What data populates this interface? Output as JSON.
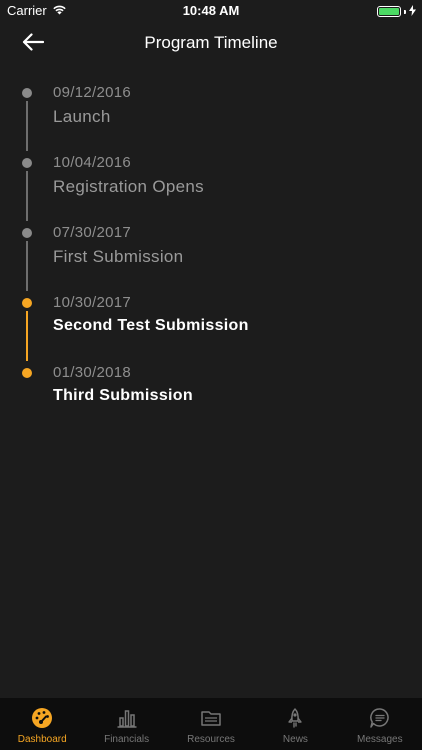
{
  "status_bar": {
    "carrier": "Carrier",
    "time": "10:48 AM"
  },
  "nav": {
    "title": "Program Timeline",
    "back_icon": "arrow-left-icon"
  },
  "colors": {
    "background": "#1c1c1c",
    "accent": "#f6a623",
    "inactive": "#8a8a8a",
    "battery": "#4cd964"
  },
  "timeline": [
    {
      "date": "09/12/2016",
      "title": "Launch",
      "active": false
    },
    {
      "date": "10/04/2016",
      "title": "Registration Opens",
      "active": false
    },
    {
      "date": "07/30/2017",
      "title": "First Submission",
      "active": false
    },
    {
      "date": "10/30/2017",
      "title": "Second Test Submission",
      "active": true
    },
    {
      "date": "01/30/2018",
      "title": "Third Submission",
      "active": true
    }
  ],
  "tabs": [
    {
      "label": "Dashboard",
      "icon": "dashboard-gauge-icon",
      "active": true
    },
    {
      "label": "Financials",
      "icon": "bar-chart-icon",
      "active": false
    },
    {
      "label": "Resources",
      "icon": "folder-icon",
      "active": false
    },
    {
      "label": "News",
      "icon": "rocket-icon",
      "active": false
    },
    {
      "label": "Messages",
      "icon": "message-icon",
      "active": false
    }
  ]
}
